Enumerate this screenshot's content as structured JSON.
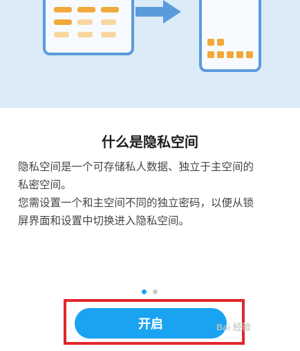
{
  "intro": {
    "title": "什么是隐私空间",
    "description_line1": "隐私空间是一个可存储私人数据、独立于主空间的",
    "description_line2": "私密空间。",
    "description_line3": "您需设置一个和主空间不同的独立密码，以便从锁",
    "description_line4": "屏界面和设置中切换进入隐私空间。"
  },
  "pager": {
    "pages": 2,
    "active_index": 0
  },
  "action": {
    "open_label": "开启"
  },
  "watermark": {
    "text": "Bai 经验"
  },
  "colors": {
    "hero_background": "#dcebf8",
    "illustration_frame": "#5a9bdc",
    "illustration_item": "#f2a93b",
    "illustration_item_light": "#f8d6a0",
    "primary_button": "#1aa3f0",
    "highlight_box": "#e0262c",
    "pager_active": "#1aa3f0",
    "pager_inactive": "#c8c8c8"
  },
  "icons": {
    "tablet": "tablet-illustration",
    "arrow": "arrow-right-icon",
    "phone": "phone-illustration"
  }
}
